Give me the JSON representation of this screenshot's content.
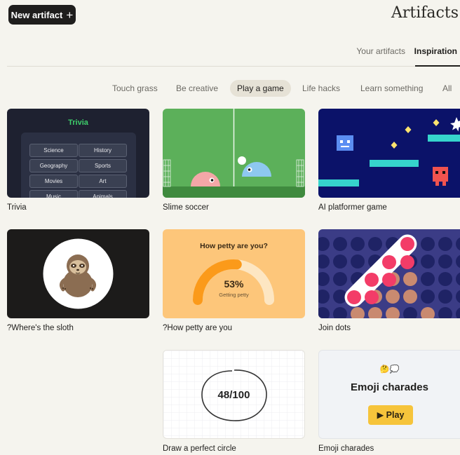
{
  "header": {
    "new_artifact_label": "New artifact",
    "title": "Artifacts"
  },
  "tabs": [
    {
      "label": "Your artifacts",
      "active": false
    },
    {
      "label": "Inspiration",
      "active": true
    }
  ],
  "categories": [
    {
      "label": "Touch grass",
      "active": false
    },
    {
      "label": "Be creative",
      "active": false
    },
    {
      "label": "Play a game",
      "active": true
    },
    {
      "label": "Life hacks",
      "active": false
    },
    {
      "label": "Learn something",
      "active": false
    },
    {
      "label": "All",
      "active": false
    }
  ],
  "cards": [
    {
      "label": "Trivia"
    },
    {
      "label": "Slime soccer"
    },
    {
      "label": "AI platformer game"
    },
    {
      "label": "?Where's the sloth"
    },
    {
      "label": "?How petty are you"
    },
    {
      "label": "Join dots"
    },
    {
      "label": "Draw a perfect circle"
    },
    {
      "label": "Emoji charades"
    }
  ],
  "trivia_thumb": {
    "title": "Trivia",
    "topics": [
      "Science",
      "History",
      "Geography",
      "Sports",
      "Movies",
      "Art",
      "Music",
      "Animals"
    ]
  },
  "petty_thumb": {
    "question": "How petty are you?",
    "percent_label": "53%",
    "status": "Getting petty",
    "percent_value": 53
  },
  "circle_thumb": {
    "score": "48/100"
  },
  "charades_thumb": {
    "emoji": "🤔💭",
    "title": "Emoji charades",
    "play_label": "▶ Play"
  },
  "colors": {
    "accent_dark": "#1f1e1d",
    "trivia_bg": "#1e2130",
    "trivia_title": "#3ecf6b",
    "soccer_grass": "#5cb05a",
    "platformer_bg": "#0b1269",
    "petty_bg": "#fdc67a",
    "petty_arc": "#fb9a1a",
    "dots_bg": "#3b3c86",
    "dots_active": "#f33c68"
  }
}
